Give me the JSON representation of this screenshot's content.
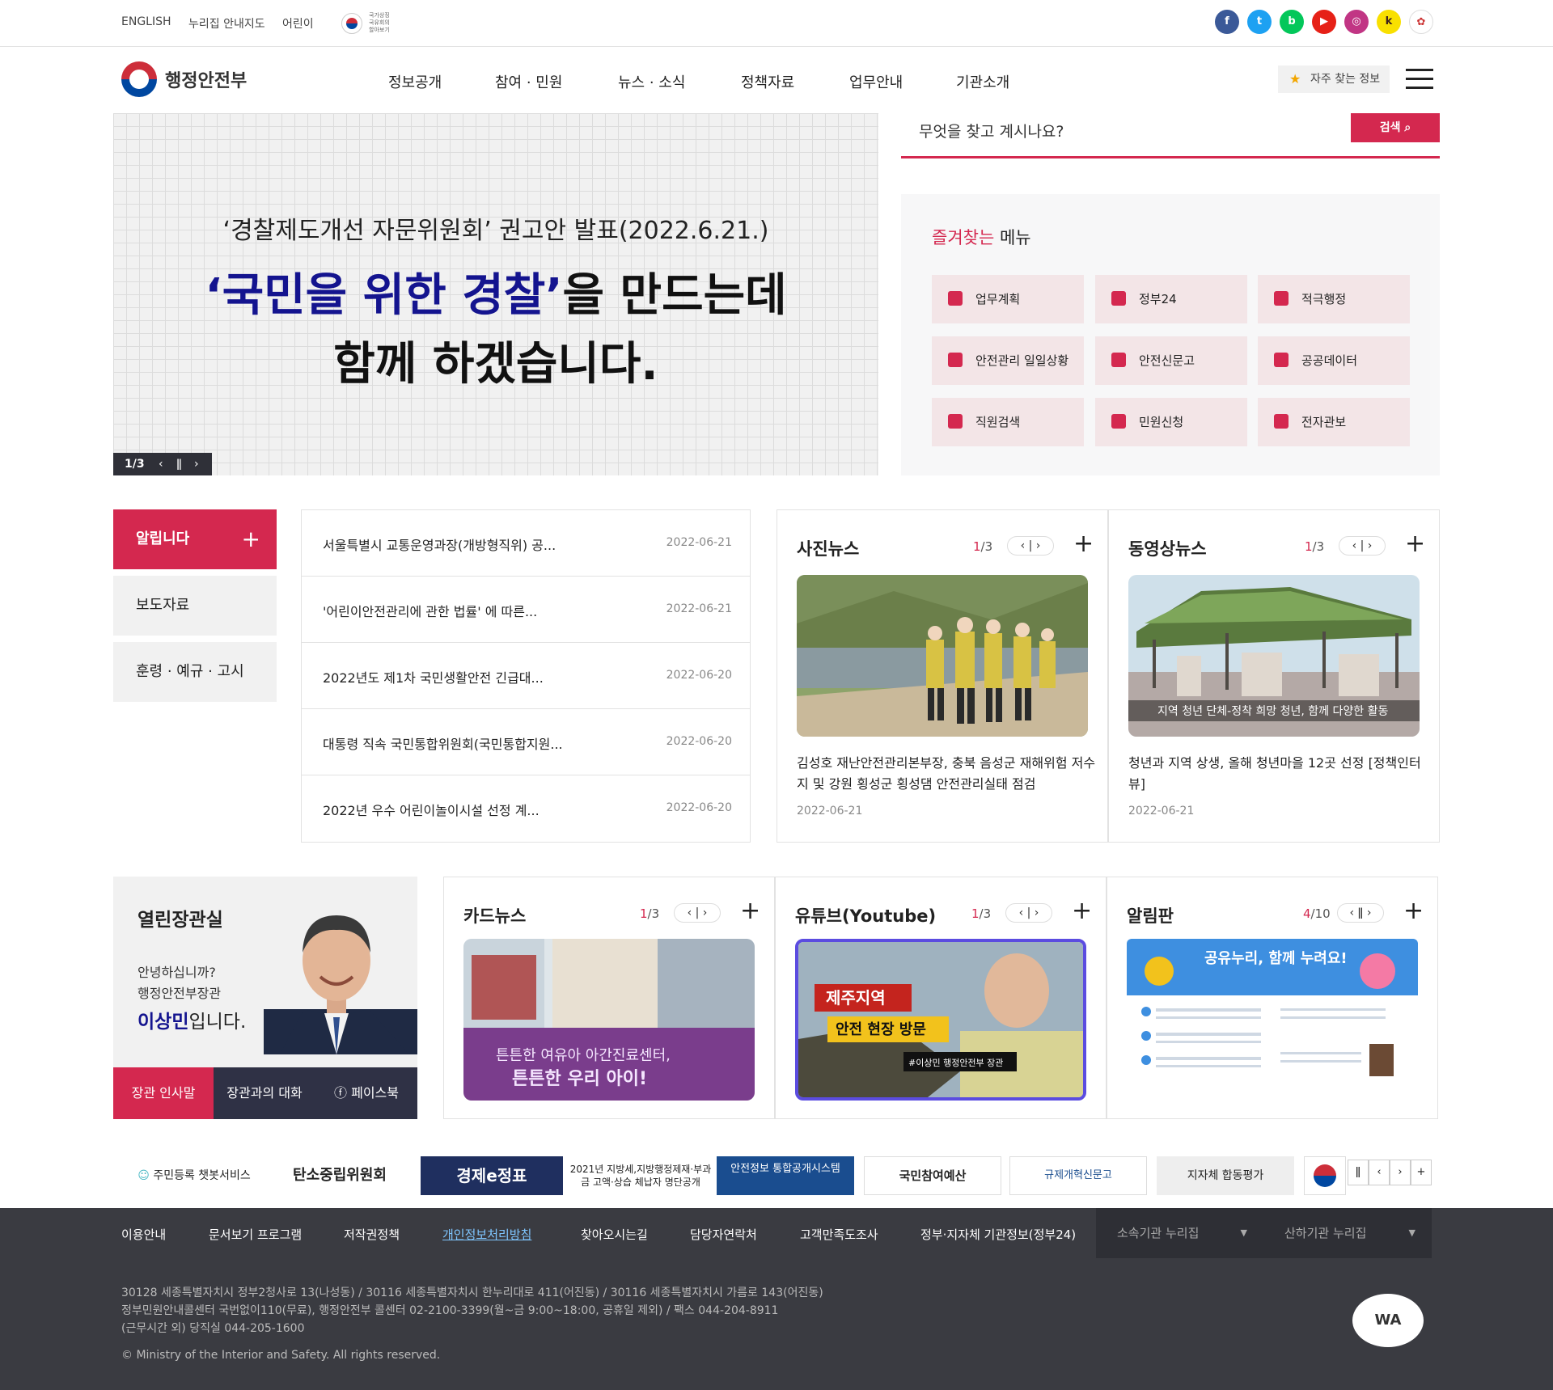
{
  "topbar": {
    "links": [
      "ENGLISH",
      "누리집 안내지도",
      "어린이"
    ],
    "flag_caption": "국가상징 국유회의 할아보기",
    "sns": [
      {
        "icon": "facebook-icon",
        "label": "f",
        "color": "#3b5998"
      },
      {
        "icon": "twitter-icon",
        "label": "t",
        "color": "#1da1f2"
      },
      {
        "icon": "blog-icon",
        "label": "b",
        "color": "#03c75a"
      },
      {
        "icon": "youtube-icon",
        "label": "▶",
        "color": "#e62117"
      },
      {
        "icon": "instagram-icon",
        "label": "◎",
        "color": "#c13584"
      },
      {
        "icon": "kakao-icon",
        "label": "k",
        "color": "#f9e000"
      },
      {
        "icon": "etc-sns-icon",
        "label": "✿",
        "color": "#ffffff"
      }
    ]
  },
  "header": {
    "logo_text": "행정안전부",
    "menu": [
      "정보공개",
      "참여 · 민원",
      "뉴스 · 소식",
      "정책자료",
      "업무안내",
      "기관소개"
    ],
    "fav_label": "자주 찾는 정보"
  },
  "hero": {
    "line1": "‘경찰제도개선 자문위원회’ 권고안 발표(2022.6.21.)",
    "line2_highlight": "‘국민을 위한 경찰’",
    "line2_rest": "을 만드는데",
    "line3": "함께 하겠습니다.",
    "counter": "1/3"
  },
  "search": {
    "placeholder": "무엇을 찾고 계시나요?",
    "button": "검색"
  },
  "favorites": {
    "title_highlight": "즐겨찾는",
    "title_rest": " 메뉴",
    "items": [
      "업무계획",
      "정부24",
      "적극행정",
      "안전관리 일일상황",
      "안전신문고",
      "공공데이터",
      "직원검색",
      "민원신청",
      "전자관보"
    ]
  },
  "notice": {
    "tabs": [
      "알립니다",
      "보도자료",
      "훈령 · 예규 · 고시"
    ],
    "rows": [
      {
        "title": "서울특별시 교통운영과장(개방형직위) 공...",
        "date": "2022-06-21"
      },
      {
        "title": "'어린이안전관리에 관한 법률' 에 따른...",
        "date": "2022-06-21"
      },
      {
        "title": "2022년도 제1차 국민생활안전 긴급대...",
        "date": "2022-06-20"
      },
      {
        "title": "대통령 직속 국민통합위원회(국민통합지원...",
        "date": "2022-06-20"
      },
      {
        "title": "2022년 우수 어린이놀이시설 선정 계...",
        "date": "2022-06-20"
      }
    ]
  },
  "photo_news": {
    "title": "사진뉴스",
    "page_current": "1",
    "page_total": "/3",
    "caption": "김성호 재난안전관리본부장, 충북 음성군 재해위험 저수지 및 강원 횡성군 횡성댐 안전관리실태 점검",
    "date": "2022-06-21"
  },
  "video_news": {
    "title": "동영상뉴스",
    "page_current": "1",
    "page_total": "/3",
    "overlay": "지역 청년 단체-정착 희망 청년, 함께 다양한 활동",
    "caption": "청년과 지역 상생, 올해 청년마을 12곳 선정 [정책인터뷰]",
    "date": "2022-06-21"
  },
  "minister": {
    "title": "열린장관실",
    "greeting1": "안녕하십니까?",
    "greeting2": "행정안전부장관",
    "name": "이상민",
    "name_suffix": "입니다.",
    "buttons": [
      "장관 인사말",
      "장관과의 대화",
      "페이스북"
    ]
  },
  "card_news": {
    "title": "카드뉴스",
    "page_current": "1",
    "page_total": "/3",
    "img_text1": "튼튼한 여유아 아간진료센터,",
    "img_text2": "튼튼한 우리 아이!"
  },
  "youtube": {
    "title": "유튜브(Youtube)",
    "page_current": "1",
    "page_total": "/3",
    "tag1": "제주지역",
    "tag2": "안전 현장 방문",
    "tag3": "#이상민 행정안전부 장관"
  },
  "board": {
    "title": "알림판",
    "page_current": "4",
    "page_total": "/10",
    "img_title": "공유누리, 함께 누려요!"
  },
  "banners": [
    "주민등록 챗봇서비스",
    "탄소중립위원회",
    "경제e정표",
    "2021년 지방세,지방행정제재·부과금 고액·상습 체납자 명단공개",
    "안전정보 통합공개시스템",
    "국민참여예산",
    "규제개혁신문고",
    "지자체 합동평가"
  ],
  "footer_nav": {
    "links": [
      "이용안내",
      "문서보기 프로그램",
      "저작권정책",
      "개인정보처리방침",
      "찾아오시는길",
      "담당자연락처",
      "고객만족도조사",
      "정부·지자체 기관정보(정부24)"
    ],
    "selects": [
      "소속기관 누리집",
      "산하기관 누리집"
    ]
  },
  "footer": {
    "addr1": "30128 세종특별자치시 정부2청사로 13(나성동) / 30116 세종특별자치시 한누리대로 411(어진동) / 30116 세종특별자치시 가름로 143(어진동)",
    "addr2": "정부민원안내콜센터 국번없이110(무료), 행정안전부 콜센터 02-2100-3399(월~금 9:00~18:00, 공휴일 제외) / 팩스 044-204-8911",
    "addr3": "(근무시간 외) 당직실 044-205-1600",
    "copyright": "© Ministry of the Interior and Safety. All rights reserved.",
    "badge": "WA"
  }
}
